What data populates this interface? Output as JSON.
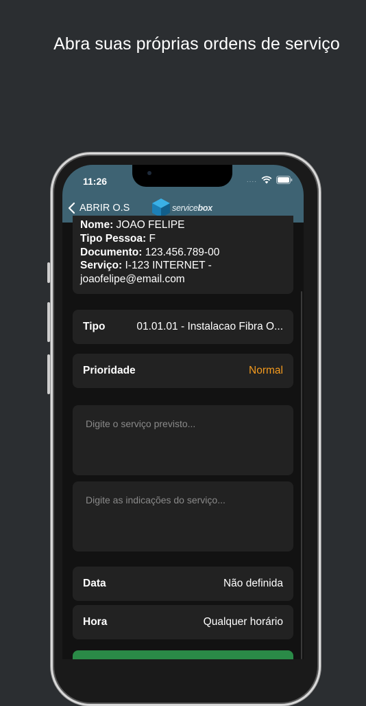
{
  "headline": "Abra suas próprias ordens de serviço",
  "status_bar": {
    "time": "11:26",
    "dots": "....",
    "icons": [
      "wifi-icon",
      "battery-icon"
    ]
  },
  "nav": {
    "back_label": "ABRIR O.S",
    "brand_prefix": "service",
    "brand_suffix": "box"
  },
  "client": {
    "nome_label": "Nome:",
    "nome": "JOAO FELIPE",
    "tipo_pessoa_label": "Tipo Pessoa:",
    "tipo_pessoa": "F",
    "documento_label": "Documento:",
    "documento": "123.456.789-00",
    "servico_label": "Serviço:",
    "servico": "I-123 INTERNET -",
    "email": "joaofelipe@email.com"
  },
  "form": {
    "tipo_label": "Tipo",
    "tipo_value": "01.01.01 - Instalacao Fibra O...",
    "prioridade_label": "Prioridade",
    "prioridade_value": "Normal",
    "servico_previsto_placeholder": "Digite o serviço previsto...",
    "indicacoes_placeholder": "Digite as indicações do serviço...",
    "data_label": "Data",
    "data_value": "Não definida",
    "hora_label": "Hora",
    "hora_value": "Qualquer horário"
  },
  "colors": {
    "topbar": "#3e6373",
    "accent_orange": "#f39a1e",
    "card": "#222222",
    "background": "#2b2e31"
  }
}
